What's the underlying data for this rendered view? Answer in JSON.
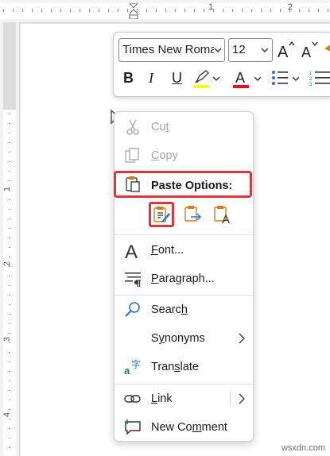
{
  "ruler": {
    "top_numbers": [
      "1",
      "2"
    ],
    "left_numbers": [
      "1",
      "2",
      "3",
      "4"
    ]
  },
  "mini_toolbar": {
    "font_name": "Times New Roma",
    "font_size": "12",
    "bold_label": "B",
    "italic_label": "I",
    "underline_label": "U",
    "highlight_color": "#ffff00",
    "font_color": "#e81123"
  },
  "context_menu": {
    "items": [
      {
        "label": "Cut",
        "mnemonic": "t",
        "enabled": false,
        "icon": "scissors-icon"
      },
      {
        "label": "Copy",
        "mnemonic": "C",
        "enabled": false,
        "icon": "copy-icon"
      },
      {
        "label": "Paste Options:",
        "icon": "clipboard-icon"
      },
      {
        "label": "Font...",
        "icon": "font-letter-icon"
      },
      {
        "label": "Paragraph...",
        "icon": "paragraph-icon"
      },
      {
        "label": "Search",
        "icon": "search-icon"
      },
      {
        "label": "Synonyms",
        "icon": "none",
        "has_submenu": true
      },
      {
        "label": "Translate",
        "icon": "translate-icon"
      },
      {
        "label": "Link",
        "icon": "link-icon",
        "has_submenu": true
      },
      {
        "label": "New Comment",
        "icon": "comment-icon"
      }
    ],
    "paste_options": [
      {
        "name": "keep-source-formatting",
        "selected": true
      },
      {
        "name": "merge-formatting",
        "selected": false
      },
      {
        "name": "keep-text-only",
        "selected": false
      }
    ]
  },
  "watermark": "wsxdn.com",
  "colors": {
    "accent_red": "#d9373b",
    "icon_blue": "#2b73c7",
    "icon_orange": "#d27d1a"
  }
}
